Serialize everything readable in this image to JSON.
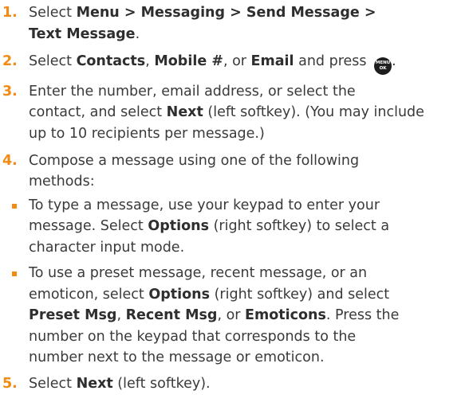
{
  "accent_color": "#f28a13",
  "steps": [
    {
      "number": "1.",
      "line1": {
        "prefix": "Select ",
        "bold": "Menu > Messaging > Send Message >"
      },
      "line2_bold": "Text Message",
      "line2_suffix": "."
    },
    {
      "number": "2.",
      "prefix": "Select ",
      "bold1": "Contacts",
      "sep1": ", ",
      "bold2": "Mobile #",
      "sep2": ", or ",
      "bold3": "Email",
      "suffix": " and press ",
      "icon": {
        "name": "menu-ok-button-icon",
        "line1": "MENU",
        "line2": "OK"
      },
      "end": "."
    },
    {
      "number": "3.",
      "line1": "Enter the number, email address, or select the",
      "line2_prefix": "contact, and select ",
      "line2_bold": "Next",
      "line2_suffix": " (left softkey). (You may include",
      "line3": "up to 10 recipients per message.)"
    },
    {
      "number": "4.",
      "line1": "Compose a message using one of the following",
      "line2": "methods:",
      "bullets": [
        {
          "line1": "To type a message, use your keypad to enter your",
          "line2_prefix": "message. Select ",
          "line2_bold": "Options",
          "line2_suffix": " (right softkey) to select a",
          "line3": "character input mode."
        },
        {
          "line1": "To use a preset message, recent message, or an",
          "line2_prefix": "emoticon, select ",
          "line2_bold": "Options",
          "line2_suffix": " (right softkey) and select",
          "line3_bold1": "Preset Msg",
          "line3_sep1": ", ",
          "line3_bold2": "Recent Msg",
          "line3_sep2": ", or ",
          "line3_bold3": "Emoticons",
          "line3_suffix": ". Press the",
          "line4": "number on the keypad that corresponds to the",
          "line5": "number next to the message or emoticon."
        }
      ]
    },
    {
      "number": "5.",
      "prefix": "Select ",
      "bold": "Next",
      "suffix": " (left softkey)."
    }
  ]
}
